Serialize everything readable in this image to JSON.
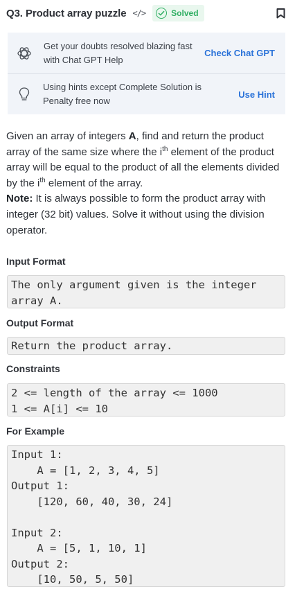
{
  "header": {
    "title": "Q3. Product array puzzle",
    "code_icon": "</>",
    "solved_label": "Solved"
  },
  "help": {
    "chatgpt_line1": "Get your doubts resolved blazing fast",
    "chatgpt_line2": "with Chat GPT Help",
    "chatgpt_link": "Check Chat GPT",
    "hint_line1": "Using hints except Complete Solution is",
    "hint_line2": "Penalty free now",
    "hint_link": "Use Hint"
  },
  "description": {
    "p1": "Given an array of integers ",
    "p1_bold": "A",
    "p2": ", find and return the product array of the same size where the i",
    "p2_sup": "th",
    "p3": " element of the product array will be equal to the product of all the elements divided by the i",
    "p3_sup": "th",
    "p4": " element of the array.",
    "note_label": "Note:",
    "note_text": " It is always possible to form the product array with integer (32 bit) values. Solve it without using the division operator."
  },
  "sections": {
    "input_format_title": "Input Format",
    "input_format": "The only argument given is the integer\narray A.",
    "output_format_title": "Output Format",
    "output_format": "Return the product array.",
    "constraints_title": "Constraints",
    "constraints": "2 <= length of the array <= 1000\n1 <= A[i] <= 10",
    "example_title": "For Example",
    "example": "Input 1:\n    A = [1, 2, 3, 4, 5]\nOutput 1:\n    [120, 60, 40, 30, 24]\n\nInput 2:\n    A = [5, 1, 10, 1]\nOutput 2:\n    [10, 50, 5, 50]"
  },
  "colors": {
    "accent_link": "#2b73d9",
    "solved_green": "#2fae62",
    "help_bg": "#f1f4f9",
    "code_bg": "#f0f0f0"
  },
  "icons": {
    "code": "code-icon",
    "solved": "check-circle-icon",
    "bookmark": "bookmark-icon",
    "chatgpt": "openai-logo-icon",
    "hint": "lightbulb-icon"
  }
}
